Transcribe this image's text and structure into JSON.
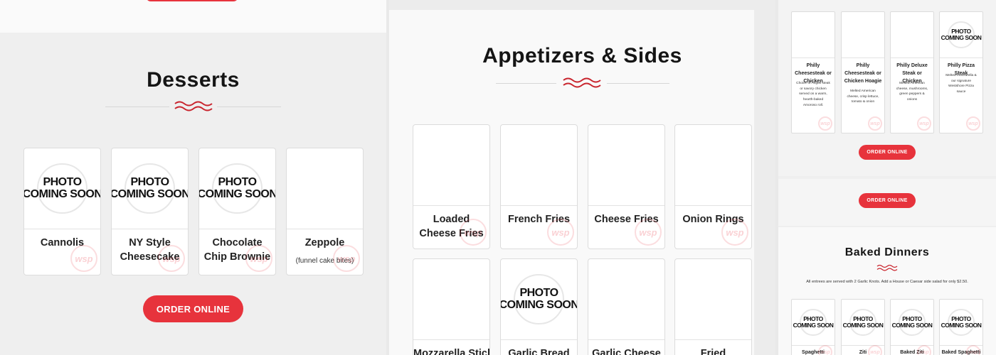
{
  "colors": {
    "accent": "#e7333c",
    "background": "#efefef",
    "card": "#ffffff"
  },
  "placeholder": {
    "line1": "PHOTO",
    "line2": "COMING SOON"
  },
  "watermark": "wsp",
  "desserts": {
    "title": "Desserts",
    "items": [
      {
        "name": "Cannolis",
        "photo": true
      },
      {
        "name": "NY Style Cheesecake",
        "photo": true
      },
      {
        "name": "Chocolate Chip Brownie",
        "photo": true
      },
      {
        "name": "Zeppole",
        "sub": "(funnel cake bites)",
        "photo": false
      }
    ],
    "order_label": "ORDER ONLINE"
  },
  "appetizers": {
    "title": "Appetizers & Sides",
    "row1": [
      {
        "name": "Loaded Cheese Fries"
      },
      {
        "name": "French Fries"
      },
      {
        "name": "Cheese Fries"
      },
      {
        "name": "Onion Rings"
      }
    ],
    "row2": [
      {
        "name": "Mozzarella Sticks",
        "photo": false
      },
      {
        "name": "Garlic Bread",
        "photo": true
      },
      {
        "name": "Garlic Cheese",
        "photo": false
      },
      {
        "name": "Fried",
        "photo": false
      }
    ]
  },
  "philly": {
    "items": [
      {
        "name": "Philly Cheesesteak or Chicken",
        "desc": "Choice of Angus steak or savory chicken served on a warm, hearth-baked Amoroso roll.",
        "photo": false
      },
      {
        "name": "Philly Cheesesteak or Chicken Hoagie",
        "desc": "Melted American cheese, crisp lettuce, tomato & onion",
        "photo": false
      },
      {
        "name": "Philly Deluxe Steak or Chicken",
        "desc": "Melted American cheese, mushrooms, green peppers & onions",
        "photo": false
      },
      {
        "name": "Philly Pizza Steak",
        "desc": "Melted mozzarella & our signature Westshore Pizza sauce",
        "photo": true
      }
    ],
    "order_label": "ORDER ONLINE"
  },
  "order_label_2": "ORDER ONLINE",
  "baked": {
    "title": "Baked Dinners",
    "note": "All entrees are served with 2 Garlic Knots. Add a House or Caesar side salad for only $2.50.",
    "items": [
      {
        "name": "Spaghetti"
      },
      {
        "name": "Ziti"
      },
      {
        "name": "Baked Ziti"
      },
      {
        "name": "Baked Spaghetti"
      }
    ]
  }
}
